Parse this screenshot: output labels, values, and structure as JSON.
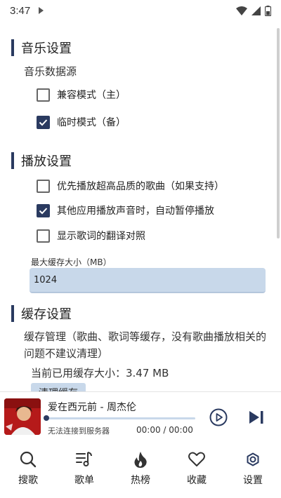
{
  "status_bar": {
    "time": "3:47"
  },
  "sections": {
    "music": {
      "title": "音乐设置",
      "source_label": "音乐数据源",
      "options": [
        {
          "label": "兼容模式（主）",
          "checked": false
        },
        {
          "label": "临时模式（备）",
          "checked": true
        }
      ]
    },
    "playback": {
      "title": "播放设置",
      "options": [
        {
          "label": "优先播放超高品质的歌曲（如果支持）",
          "checked": false
        },
        {
          "label": "其他应用播放声音时，自动暂停播放",
          "checked": true
        },
        {
          "label": "显示歌词的翻译对照",
          "checked": false
        }
      ],
      "cache_size_label": "最大缓存大小（MB）",
      "cache_size_value": "1024"
    },
    "cache": {
      "title": "缓存设置",
      "description": "缓存管理（歌曲、歌词等缓存，没有歌曲播放相关的问题不建议清理）",
      "current_usage": "当前已用缓存大小：3.47 MB",
      "clear_button": "清理缓存"
    }
  },
  "player": {
    "song": "爱在西元前 - 周杰伦",
    "status": "无法连接到服务器",
    "time": "00:00 / 00:00",
    "progress": 0
  },
  "nav": [
    {
      "label": "搜歌",
      "icon": "search-icon"
    },
    {
      "label": "歌单",
      "icon": "playlist-icon"
    },
    {
      "label": "热榜",
      "icon": "flame-icon"
    },
    {
      "label": "收藏",
      "icon": "heart-icon"
    },
    {
      "label": "设置",
      "icon": "gear-icon"
    }
  ],
  "colors": {
    "accent": "#2a3a60",
    "input_bg": "#c8d8ea"
  }
}
